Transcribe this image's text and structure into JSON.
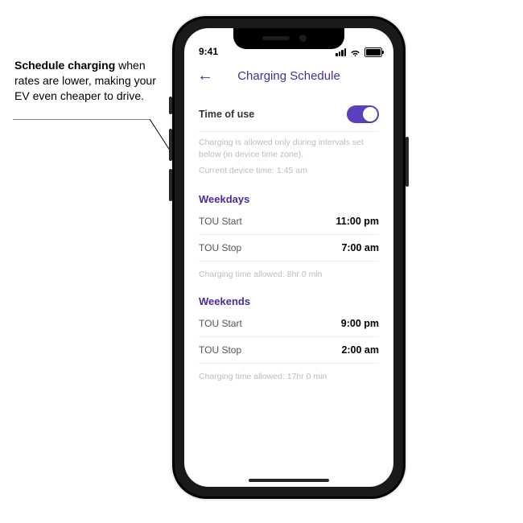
{
  "callout": {
    "bold": "Schedule charging",
    "rest": " when rates are lower, making your EV even cheaper to drive."
  },
  "status": {
    "time": "9:41"
  },
  "header": {
    "back_glyph": "←",
    "title": "Charging Schedule"
  },
  "time_of_use": {
    "label": "Time of use",
    "enabled": true,
    "helper_line1": "Charging is allowed only during intervals set below (in device time zone).",
    "helper_device_time_label": "Current device time:",
    "helper_device_time_value": "1:45 am"
  },
  "weekdays": {
    "title": "Weekdays",
    "rows": [
      {
        "label": "TOU Start",
        "value": "11:00 pm"
      },
      {
        "label": "TOU Stop",
        "value": "7:00 am"
      }
    ],
    "allowed_label": "Charging time allowed:",
    "allowed_value": "8hr 0 min"
  },
  "weekends": {
    "title": "Weekends",
    "rows": [
      {
        "label": "TOU Start",
        "value": "9:00 pm"
      },
      {
        "label": "TOU Stop",
        "value": "2:00 am"
      }
    ],
    "allowed_label": "Charging time allowed:",
    "allowed_value": "17hr 0 min"
  }
}
